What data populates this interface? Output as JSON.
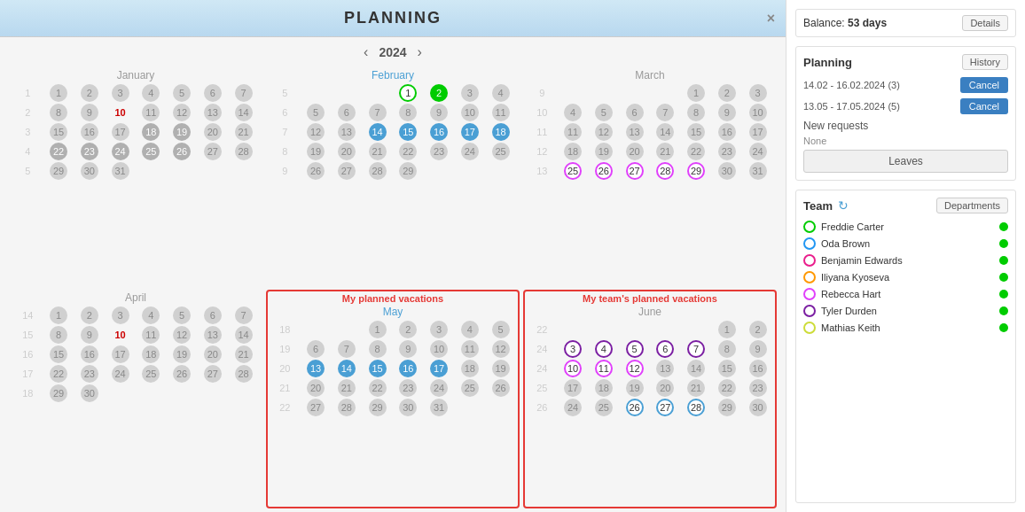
{
  "header": {
    "title": "PLANNING",
    "close_label": "×"
  },
  "year_nav": {
    "year": "2024",
    "prev_arrow": "‹",
    "next_arrow": "›"
  },
  "vacation_labels": {
    "my_planned": "My planned vacations",
    "team_planned": "My team's planned vacations"
  },
  "sidebar": {
    "balance_label": "Balance:",
    "balance_value": "53 days",
    "details_label": "Details",
    "planning_title": "Planning",
    "history_label": "History",
    "planning_rows": [
      {
        "date_range": "14.02 - 16.02.2024 (3)",
        "action": "Cancel"
      },
      {
        "date_range": "13.05 - 17.05.2024 (5)",
        "action": "Cancel"
      }
    ],
    "new_requests_title": "New requests",
    "new_requests_value": "None",
    "leaves_label": "Leaves",
    "team_title": "Team",
    "departments_label": "Departments",
    "team_members": [
      {
        "name": "Freddie Carter",
        "dot_color": "dot-green"
      },
      {
        "name": "Oda Brown",
        "dot_color": "dot-blue"
      },
      {
        "name": "Benjamin Edwards",
        "dot_color": "dot-pink"
      },
      {
        "name": "Iliyana Kyoseva",
        "dot_color": "dot-orange"
      },
      {
        "name": "Rebecca Hart",
        "dot_color": "dot-magenta"
      },
      {
        "name": "Tyler Durden",
        "dot_color": "dot-purple"
      },
      {
        "name": "Mathias Keith",
        "dot_color": "dot-yellow"
      }
    ]
  }
}
